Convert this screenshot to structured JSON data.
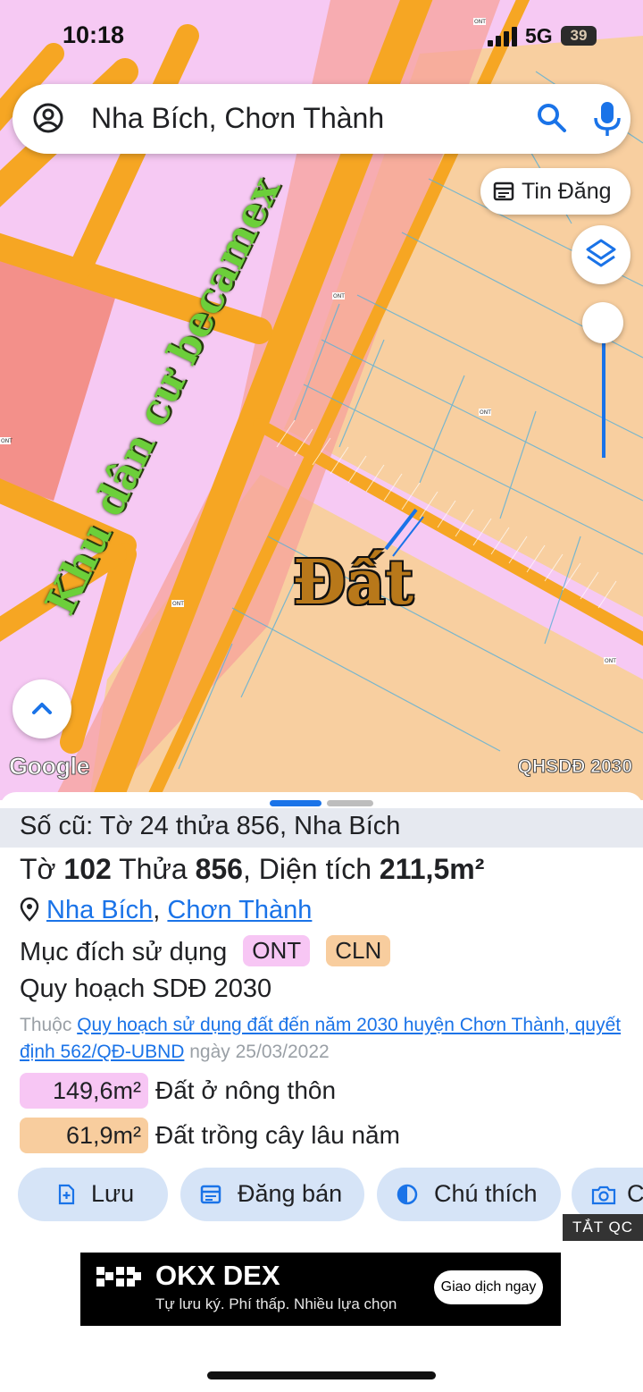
{
  "status": {
    "time": "10:18",
    "network": "5G",
    "battery": "39"
  },
  "search": {
    "query": "Nha Bích, Chơn Thành"
  },
  "buttons": {
    "tin_dang": "Tin Đăng"
  },
  "map": {
    "overlay_label_area": "Khu dân cư becamex",
    "overlay_label_land": "Đất",
    "attribution": "Google",
    "layer_name": "QHSDĐ 2030",
    "parcel_codes": [
      "ONT",
      "ONT",
      "ONT",
      "ONT",
      "ONT",
      "ONT"
    ]
  },
  "sheet": {
    "old_number": "Số cũ: Tờ 24 thửa 856, Nha Bích",
    "sheet_word": "Tờ",
    "sheet_no": "102",
    "parcel_word": "Thửa",
    "parcel_no": "856",
    "area_word": ", Diện tích",
    "area_value": "211,5m²",
    "commune": "Nha Bích",
    "district": "Chơn Thành",
    "purpose_label": "Mục đích sử dụng",
    "tags": [
      "ONT",
      "CLN"
    ],
    "plan_title": "Quy hoạch SDĐ 2030",
    "belong_prefix": "Thuộc",
    "belong_link": "Quy hoạch sử dụng đất đến năm 2030 huyện Chơn Thành, quyết định 562/QĐ-UBND",
    "belong_suffix": "ngày 25/03/2022",
    "areas": [
      {
        "value": "149,6m²",
        "label": "Đất ở nông thôn",
        "color": "#f7c6f4"
      },
      {
        "value": "61,9m²",
        "label": "Đất trồng cây lâu năm",
        "color": "#f8cd9e"
      }
    ],
    "actions": [
      "Lưu",
      "Đăng bán",
      "Chú thích",
      "C"
    ]
  },
  "ad": {
    "close_label": "TẮT QC",
    "brand": "OKX DEX",
    "subtitle": "Tự lưu ký. Phí thấp. Nhiều lựa chọn",
    "cta": "Giao dịch ngay"
  },
  "colors": {
    "accent": "#1a73e8",
    "residential": "#f7c6f4",
    "perennial": "#f8cd9e",
    "road": "#f6a623"
  }
}
